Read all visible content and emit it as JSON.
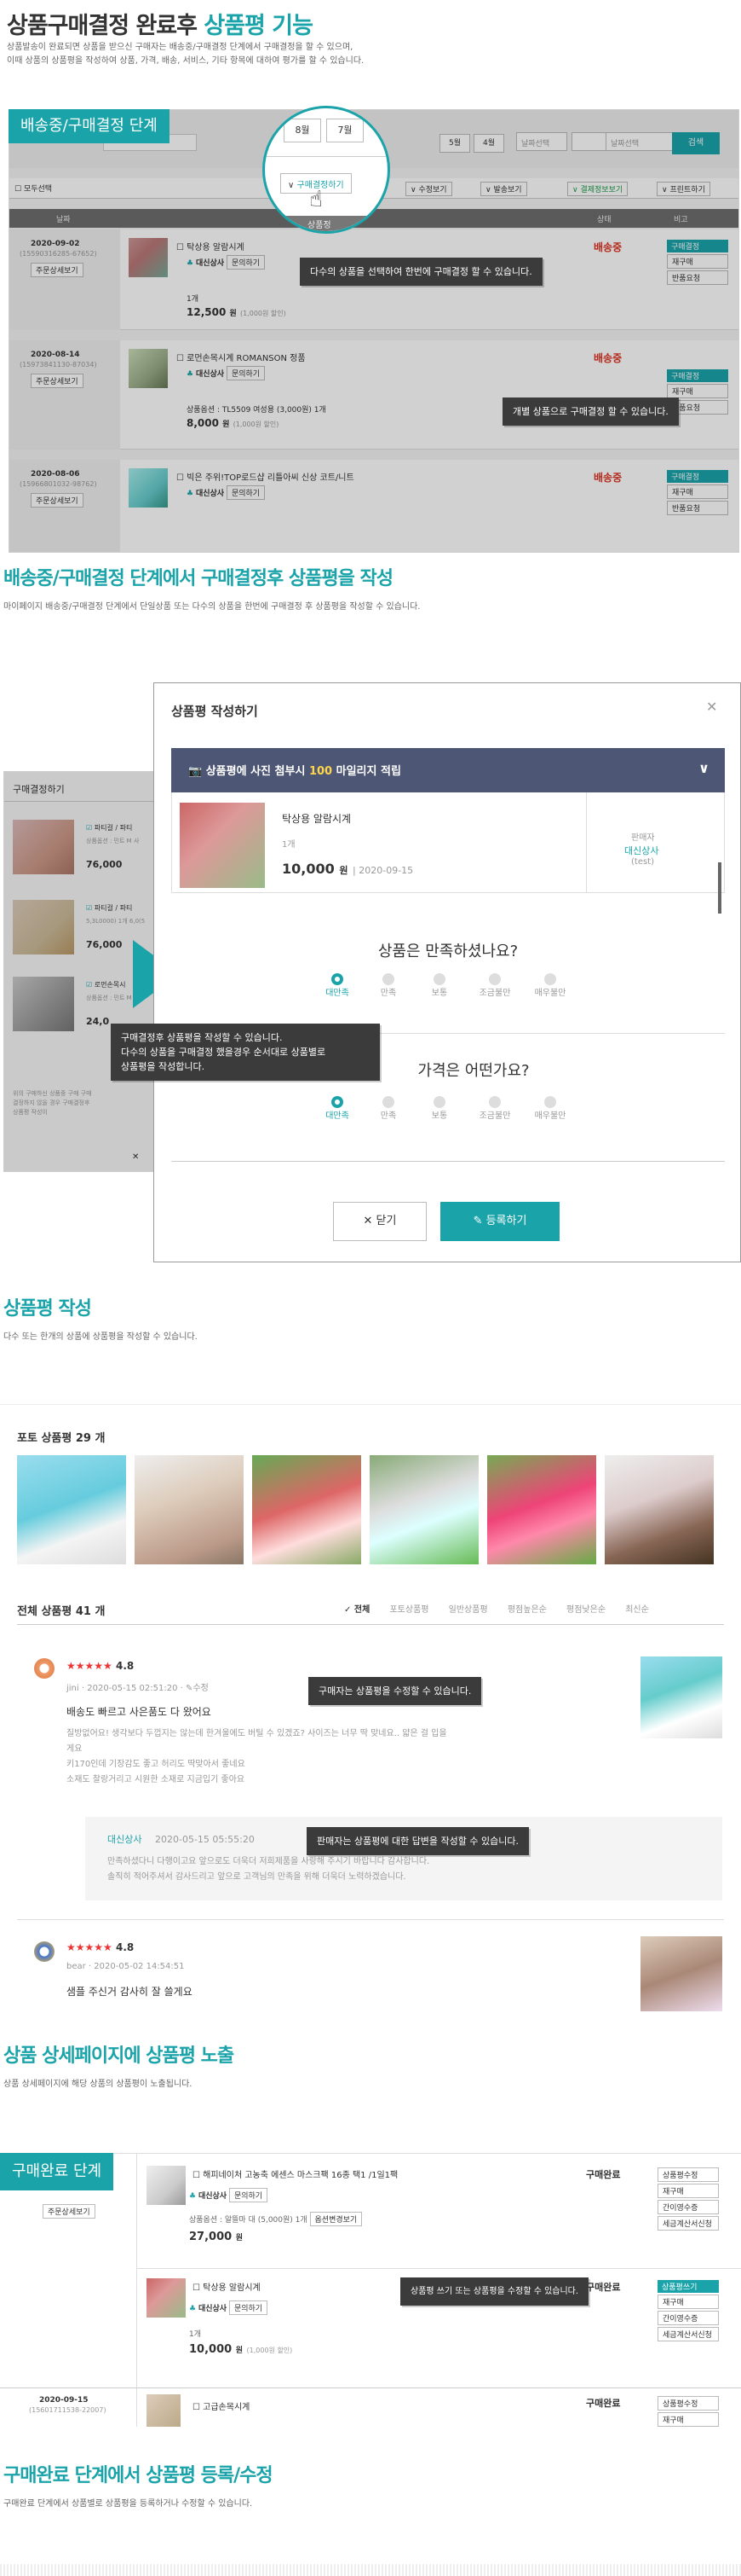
{
  "header": {
    "title_a": "상품구매결정 완료후",
    "title_b": "상품평 기능",
    "desc1": "상품발송이 완료되면 상품을 받으신 구매자는 배송중/구매결정 단계에서 구매결정을 할 수 있으며,",
    "desc2": "이때 상품의 상품평을 작성하여 상품, 가격, 배송, 서비스, 기타 항목에 대하여 평가를 할 수 있습니다."
  },
  "s1": {
    "tag": "배송중/구매결정 단계",
    "dates": [
      "8월",
      "7월",
      "5월",
      "4월"
    ],
    "select_placeholder": "날짜선택",
    "search_btn": "검색",
    "select_all": "모두선택",
    "toolbar": [
      "구매결정하기",
      "수정보기",
      "발송보기",
      "결제정보보기",
      "프린트하기"
    ],
    "col_date": "날짜",
    "col_product": "상품정",
    "col_state": "상태",
    "col_note": "비고",
    "tip_multi": "다수의 상품을 선택하여 한번에 구매결정 할 수 있습니다.",
    "tip_single": "개별 상품으로 구매결정 할 수 있습니다.",
    "orders": [
      {
        "date": "2020-09-02",
        "no": "(15590316285-67652)",
        "detail": "주문상세보기",
        "name": "탁상용 알람시계",
        "seller": "대신상사",
        "ask": "문의하기",
        "qty": "1개",
        "price": "12,500",
        "unit": "원",
        "discount": "(1,000원 할인)",
        "state": "배송중",
        "side": [
          "구매결정",
          "재구매",
          "반품요청"
        ]
      },
      {
        "date": "2020-08-14",
        "no": "(15973841130-87034)",
        "detail": "주문상세보기",
        "name": "로먼손목시계 ROMANSON 정품",
        "seller": "대신상사",
        "ask": "문의하기",
        "qty": "상품옵션 : TL5509 여성용 (3,000원) 1개",
        "price": "8,000",
        "unit": "원",
        "discount": "(1,000원 할인)",
        "state": "배송중",
        "side": [
          "구매결정",
          "재구매",
          "반품요청"
        ]
      },
      {
        "date": "2020-08-06",
        "no": "(15966801032-98762)",
        "detail": "주문상세보기",
        "name": "빅은 주위!TOP로드샵 리틀아씨 신상 코트/니트",
        "seller": "대신상사",
        "ask": "문의하기",
        "qty": "",
        "price": "",
        "unit": "",
        "discount": "",
        "state": "배송중",
        "side": [
          "구매결정",
          "재구매",
          "반품요청"
        ]
      }
    ]
  },
  "s2": {
    "title": "배송중/구매결정 단계에서 구매결정후 상품평을 작성",
    "desc": "마이페이지 배송중/구매결정 단계에서 단일상품 또는 다수의 상품을 한번에 구매결정 후 상품평을 작성할 수 있습니다.",
    "left_title": "구매결정하기",
    "left_items": [
      {
        "name": "파티걸 / 파티",
        "opt": "상품옵션 : 민트 M 사",
        "price": "76,000"
      },
      {
        "name": "파티걸 / 파티",
        "opt": "5,3L0000) 1개 6,0(5",
        "price": "76,000"
      },
      {
        "name": "로먼손목시",
        "opt": "상품옵션 : 민트 M 사",
        "price": "24,0"
      }
    ],
    "left_foot": "위의 구매하신 상품중 구매 구매결정하지 않을 경우 구매결정후 상품평 작성이",
    "modal_title": "상품평 작성하기",
    "banner_a": "상품평에 사진 첨부시",
    "banner_num": "100",
    "banner_b": "마일리지 적립",
    "prod_name": "탁상용 알람시계",
    "prod_qty": "1개",
    "prod_price": "10,000",
    "prod_unit": "원",
    "prod_date": "2020-09-15",
    "seller_label": "판매자",
    "seller_name": "대신상사",
    "seller_id": "(test)",
    "q1": "상품은 만족하셨나요?",
    "q2": "가격은 어떤가요?",
    "opts": [
      "대만족",
      "만족",
      "보통",
      "조금불만",
      "매우불만"
    ],
    "tip": "구매결정후 상품평을 작성할 수 있습니다.\n다수의 상품을 구매결정 했을경우 순서대로 상품별로\n상품평을 작성합니다.",
    "close": "닫기",
    "submit": "등록하기"
  },
  "s3": {
    "title": "상품평 작성",
    "desc": "다수 또는 한개의 상품에 상품평을 작성할 수 있습니다.",
    "photo_title": "포토 상품평 29 개",
    "all_title": "전체 상품평 41 개",
    "filters": [
      "전체",
      "포토상품평",
      "일반상품평",
      "평점높은순",
      "평점낮은순",
      "최신순"
    ],
    "r1": {
      "rating": "4.8",
      "user": "jini",
      "date": "2020-05-15 02:51:20",
      "edit": "수정",
      "title": "배송도 빠르고 사은품도 다 왔어요",
      "body1": "질방없어요! 생각보다 두껍지는 않는데 한겨울에도 버틸 수 있겠죠? 사이즈는 너무 딱 맞네요.. 얇은 걸 입을",
      "body2": "게요",
      "body3": "키170인데 기장감도 좋고 허리도 딱맞아서 좋네요",
      "body4": "소재도 찰랑거리고 시원한 소재로 지금입기 좋아요"
    },
    "tip_edit": "구매자는 상품평을 수정할 수 있습니다.",
    "reply": {
      "name": "대신상사",
      "date": "2020-05-15 05:55:20",
      "body1": "만족하셨다니 다행이고요 앞으로도 더욱더 저희제품을 사랑해 주시기 바랍니다 감사합니다.",
      "body2": "솔직히 적어주셔서 감사드리고 앞으로 고객님의 만족을 위해 더욱더 노력하겠습니다."
    },
    "tip_reply": "판매자는 상품평에 대한 답변을 작성할 수 있습니다.",
    "r2": {
      "rating": "4.8",
      "user": "bear",
      "date": "2020-05-02 14:54:51",
      "title": "샘플 주신거 감사히 잘 쓸게요"
    }
  },
  "s4": {
    "title": "상품 상세페이지에 상품평 노출",
    "desc": "상품 상세페이지에 해당 상품의 상품평이 노출됩니다.",
    "tag": "구매완료 단계",
    "detail": "주문상세보기",
    "items": [
      {
        "name": "해피네이처 고농축 에센스 마스크팩 16종 택1 /1일1팩",
        "seller": "대신상사",
        "ask": "문의하기",
        "opt": "상품옵션 : 알뜰마 대 (5,000원) 1개",
        "opt_btn": "옵션변경보기",
        "price": "27,000",
        "unit": "원",
        "discount": "",
        "state": "구매완료",
        "side": [
          "상품평수정",
          "재구매",
          "간이영수증",
          "세금계산서신청"
        ]
      },
      {
        "name": "탁상용 알람시계",
        "seller": "대신상사",
        "ask": "문의하기",
        "opt": "1개",
        "opt_btn": "",
        "price": "10,000",
        "unit": "원",
        "discount": "(1,000원 할인)",
        "state": "구매완료",
        "side": [
          "상품평쓰기",
          "재구매",
          "간이영수증",
          "세금계산서신청"
        ]
      },
      {
        "name": "고급손목시계",
        "state": "구매완료",
        "side": [
          "상품평수정",
          "재구매"
        ]
      }
    ],
    "last_date": "2020-09-15",
    "last_no": "(15601711538-22007)",
    "tip": "상품평 쓰기 또는 상품평을 수정할 수 있습니다."
  },
  "s5": {
    "title": "구매완료 단계에서 상품평 등록/수정",
    "desc": "구매완료 단계에서 상품별로 상품평을 등록하거나 수정할 수 있습니다."
  },
  "colors": {
    "accent": "#1aa4aa",
    "price_red": "#dd3322",
    "tooltip": "#3b3b3b",
    "banner": "#4d5675"
  }
}
